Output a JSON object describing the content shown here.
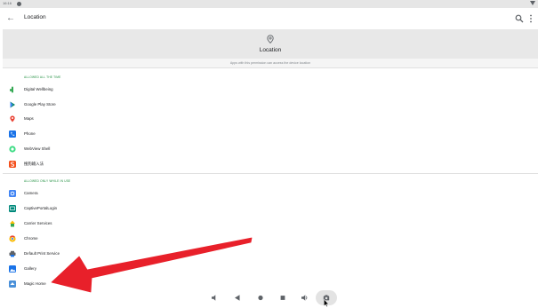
{
  "status_bar": {
    "time": "16:16"
  },
  "app_bar": {
    "title": "Location"
  },
  "header": {
    "title": "Location"
  },
  "description": "Apps with this permission can access the device location",
  "sections": [
    {
      "label": "ALLOWED ALL THE TIME",
      "apps": [
        {
          "label": "Digital Wellbeing",
          "icon": "digital-wellbeing-icon",
          "color": "#34a853"
        },
        {
          "label": "Google Play Store",
          "icon": "play-store-icon",
          "color": "#01875f"
        },
        {
          "label": "Maps",
          "icon": "maps-icon",
          "color": "#ea4335"
        },
        {
          "label": "Phone",
          "icon": "phone-icon",
          "color": "#1a73e8"
        },
        {
          "label": "WebView Shell",
          "icon": "webview-shell-icon",
          "color": "#3ddc84"
        },
        {
          "label": "搜狗输入法",
          "icon": "sogou-input-icon",
          "color": "#f4511e"
        }
      ]
    },
    {
      "label": "ALLOWED ONLY WHILE IN USE",
      "apps": [
        {
          "label": "Camera",
          "icon": "camera-icon",
          "color": "#4285f4"
        },
        {
          "label": "CaptivePortalLogin",
          "icon": "captive-portal-icon",
          "color": "#00897b"
        },
        {
          "label": "Carrier Services",
          "icon": "carrier-services-icon",
          "color": "#34a853"
        },
        {
          "label": "Chrome",
          "icon": "chrome-icon",
          "color": "#ea4335"
        },
        {
          "label": "Default Print Service",
          "icon": "print-service-icon",
          "color": "#5f6368"
        },
        {
          "label": "Gallery",
          "icon": "gallery-icon",
          "color": "#1a73e8"
        },
        {
          "label": "Magic Home",
          "icon": "magic-home-icon",
          "color": "#4a90d9"
        }
      ]
    }
  ],
  "colors": {
    "annotation_arrow": "#e8202a",
    "section_label": "#1e8e3e",
    "header_bg": "#e8e8e8"
  }
}
